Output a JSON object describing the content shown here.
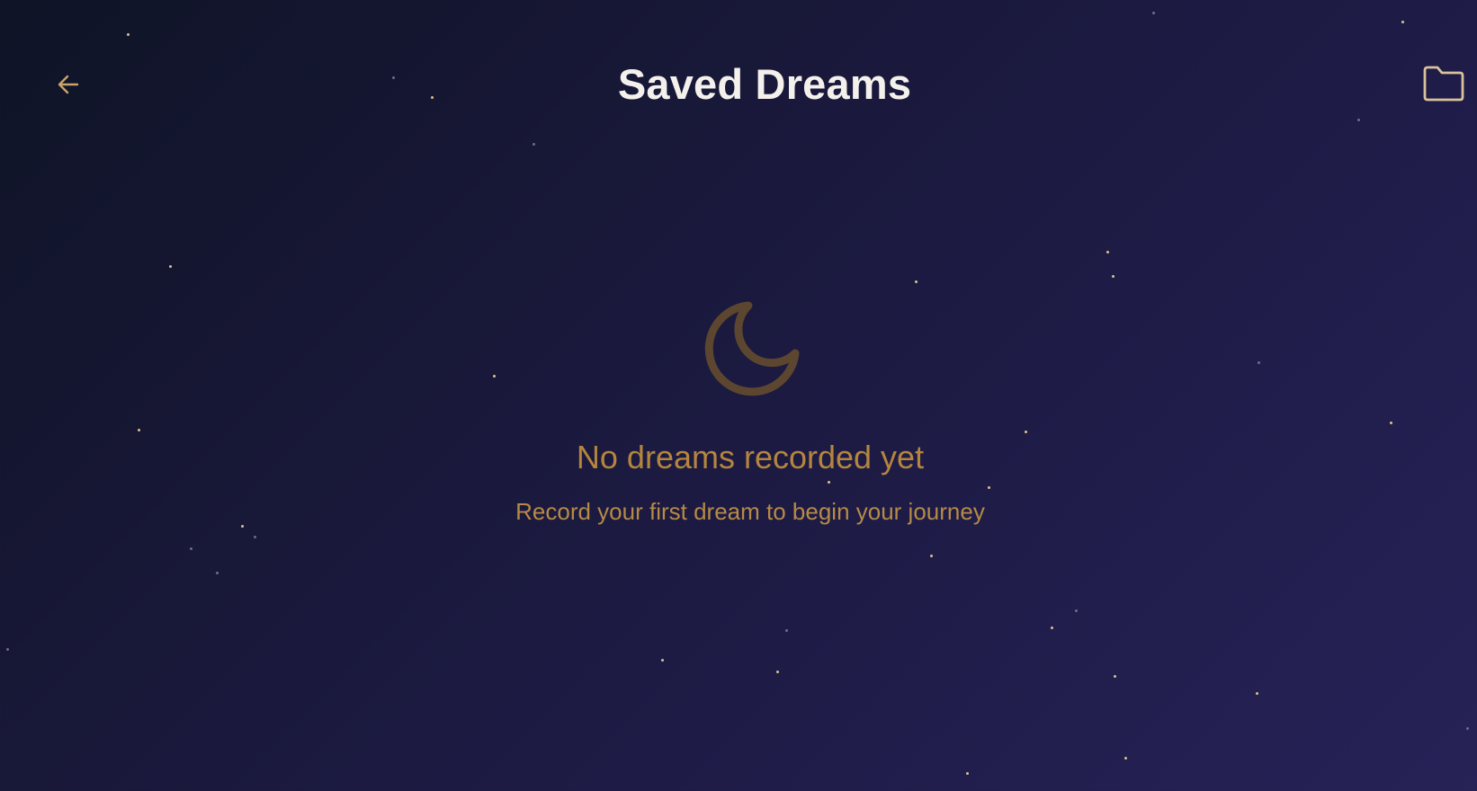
{
  "header": {
    "title": "Saved Dreams",
    "back_icon": "arrow-left-icon",
    "folder_icon": "folder-icon"
  },
  "empty_state": {
    "icon": "moon-icon",
    "title": "No dreams recorded yet",
    "subtitle": "Record your first dream to begin your journey"
  },
  "colors": {
    "background_start": "#0f1426",
    "background_end": "#272257",
    "accent_gold": "#c9a46a",
    "title_text": "#f4f1ec",
    "moon_stroke": "#5c4630",
    "empty_title": "#b5853e",
    "empty_subtitle": "#b68a47"
  }
}
